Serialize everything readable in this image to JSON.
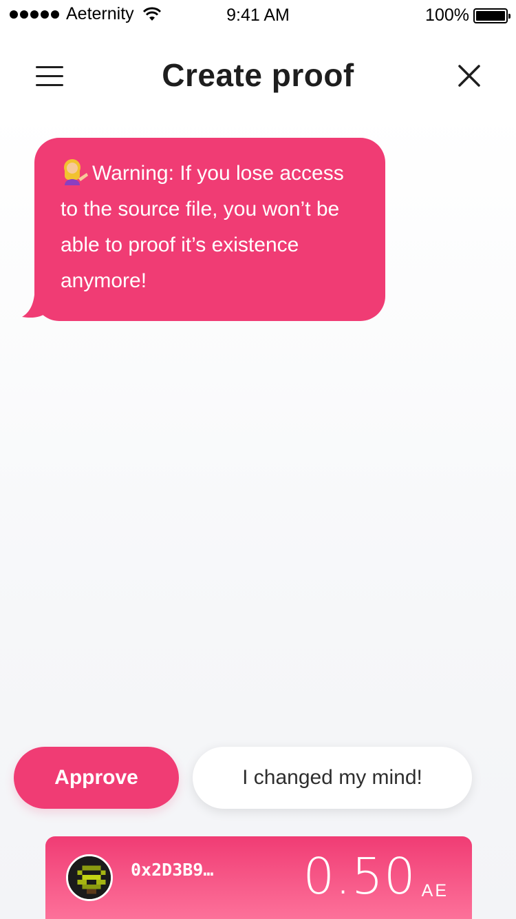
{
  "status_bar": {
    "carrier": "Aeternity",
    "time": "9:41 AM",
    "battery": "100%"
  },
  "header": {
    "title": "Create proof",
    "menu_icon": "hamburger-menu-icon",
    "close_icon": "close-icon"
  },
  "message": {
    "emoji": "woman-tipping-hand-emoji",
    "text": "Warning: If you lose access to the source file, you won’t be able to proof it’s existence anymore!"
  },
  "actions": {
    "approve_label": "Approve",
    "cancel_label": "I changed my mind!"
  },
  "account": {
    "address": "0x2D3B9…",
    "balance": "0.50",
    "unit": "AE"
  },
  "colors": {
    "accent": "#f03c74",
    "background": "#f6f7f9"
  }
}
